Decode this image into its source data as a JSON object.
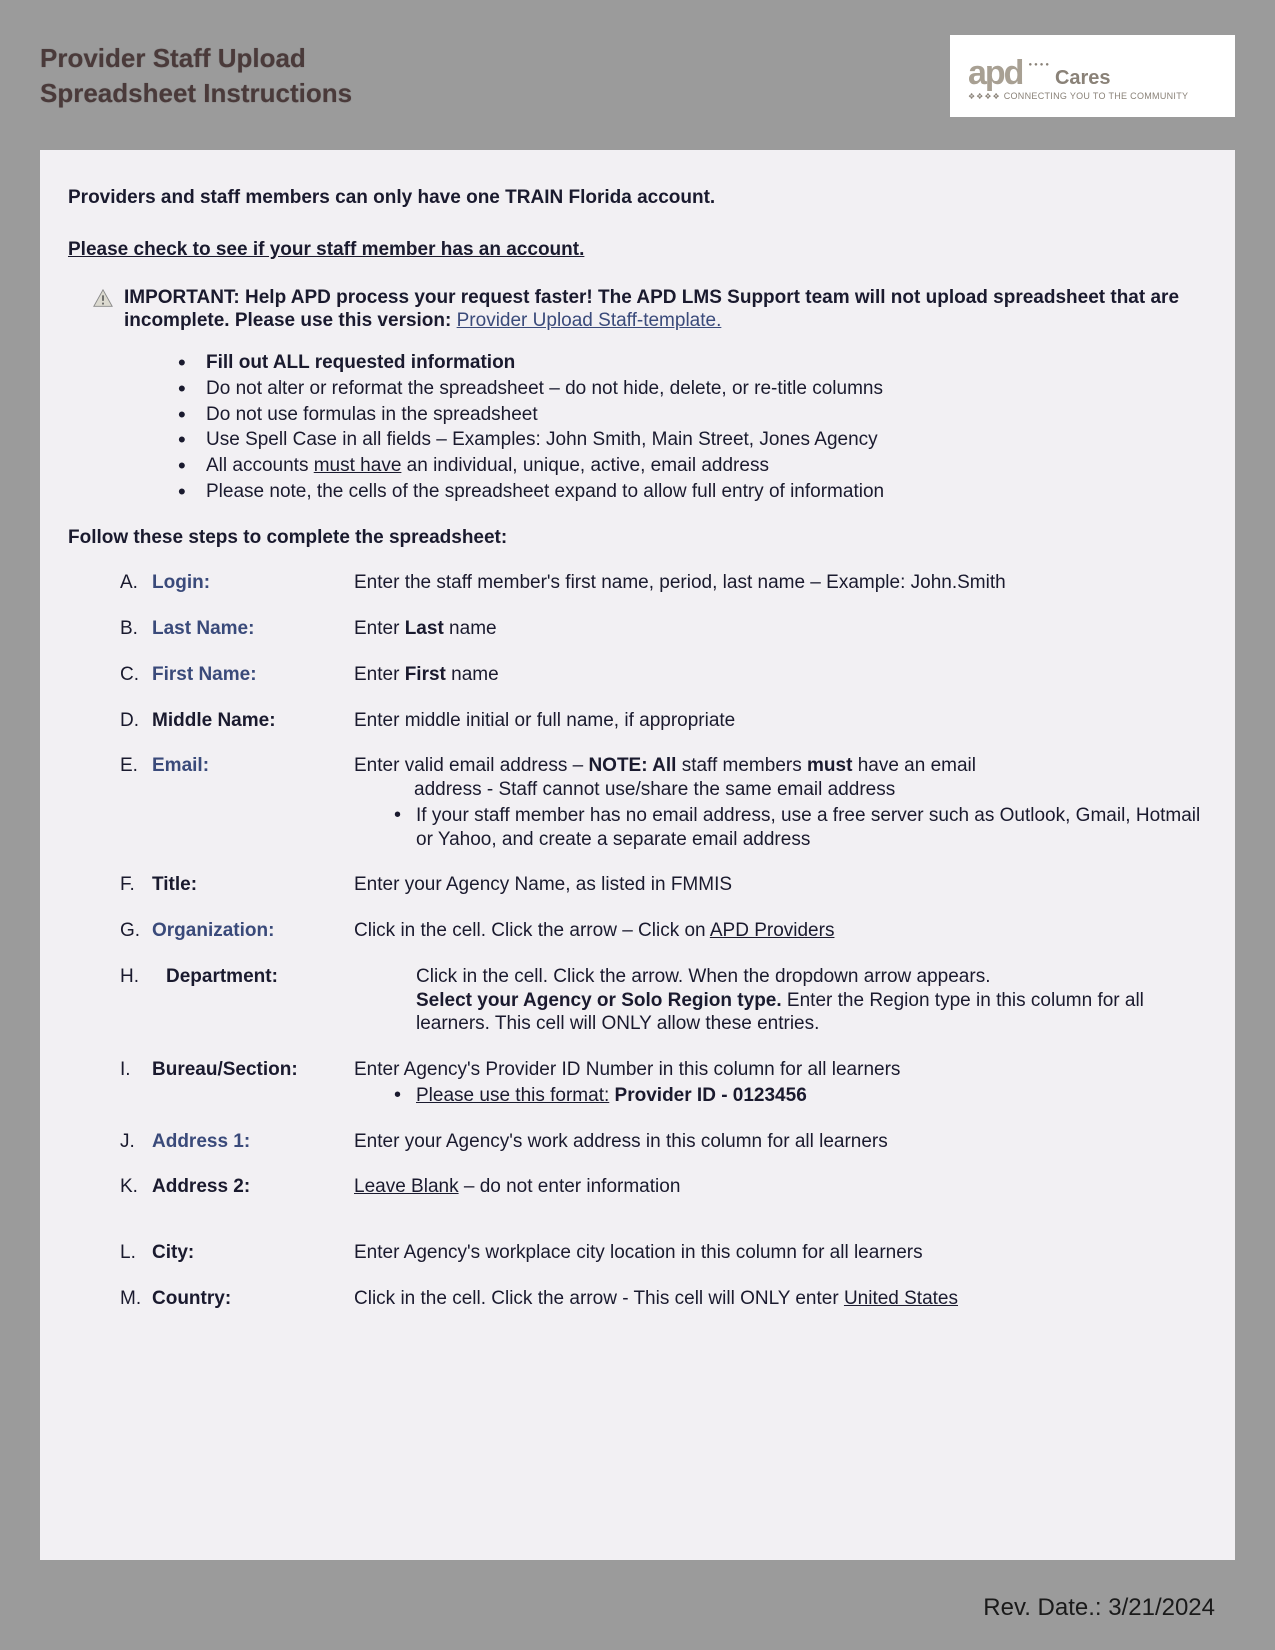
{
  "header": {
    "title_line1": "Provider Staff Upload",
    "title_line2": "Spreadsheet Instructions",
    "logo_brand": "apd",
    "logo_sub": "Cares",
    "logo_tagline": "CONNECTING YOU TO THE COMMUNITY"
  },
  "intro": "Providers and staff members can only have one TRAIN Florida account.",
  "check_link": "Please check to see if your staff member has an account.",
  "important": {
    "lead": "IMPORTANT:  Help APD process your request faster! The APD LMS Support team will not upload spreadsheet that are incomplete.  Please use this version:",
    "link_text": "Provider Upload Staff-template."
  },
  "rules": [
    {
      "bold": true,
      "text": "Fill out ALL requested information"
    },
    {
      "bold": false,
      "text": "Do not alter or reformat the spreadsheet – do not hide, delete, or re-title columns"
    },
    {
      "bold": false,
      "text": "Do not use formulas in the spreadsheet"
    },
    {
      "bold": false,
      "text": "Use Spell Case in all fields – Examples: John Smith, Main Street, Jones Agency"
    },
    {
      "bold": false,
      "pre": "All accounts ",
      "u": "must have",
      "post": " an individual, unique, active, email address"
    },
    {
      "bold": false,
      "text": "Please note, the cells of the spreadsheet expand to allow full entry of information"
    }
  ],
  "follow": "Follow these steps to complete the spreadsheet:",
  "steps": {
    "A": {
      "label": "Login:",
      "linkish": true,
      "desc": "Enter the staff member's first name, period, last name – Example: John.Smith"
    },
    "B": {
      "label": "Last Name:",
      "linkish": true,
      "desc_pre": "Enter ",
      "desc_b": "Last",
      "desc_post": " name"
    },
    "C": {
      "label": "First Name:",
      "linkish": true,
      "desc_pre": "Enter ",
      "desc_b": "First",
      "desc_post": " name"
    },
    "D": {
      "label": "Middle Name:",
      "desc": "Enter middle initial or full name, if appropriate"
    },
    "E": {
      "label": "Email:",
      "linkish": true,
      "line1_pre": "Enter valid email address – ",
      "line1_b1": "NOTE:  All",
      "line1_mid": " staff members ",
      "line1_b2": "must",
      "line1_post": " have an email",
      "line2": "address - Staff cannot use/share the same email address",
      "bullet": "If your staff member has no email address, use a free server such as Outlook, Gmail, Hotmail or Yahoo, and create a separate email address"
    },
    "F": {
      "label": "Title:",
      "desc": "Enter your Agency Name, as listed in FMMIS"
    },
    "G": {
      "label": "Organization:",
      "linkish": true,
      "desc_pre": "Click in the cell. Click the arrow – Click on ",
      "desc_u": "APD Providers"
    },
    "H": {
      "label": "Department:",
      "indent": true,
      "line1": "Click in the cell. Click the arrow. When the dropdown arrow appears.",
      "line2_b": "Select your Agency or Solo Region type.",
      "line2_post": " Enter the Region type in this column for all learners.  This cell will ONLY allow these entries."
    },
    "I": {
      "label": "Bureau/Section:",
      "line1": "Enter Agency's Provider ID Number in this column for all learners",
      "bullet_u": "Please use this format:",
      "bullet_b": " Provider ID - 0123456"
    },
    "J": {
      "label": "Address 1:",
      "linkish": true,
      "desc": "Enter your Agency's work address in this column for all learners"
    },
    "K": {
      "label": "Address 2:",
      "desc_u": "Leave Blank",
      "desc_post": " – do not enter information"
    },
    "L": {
      "label": "City:",
      "desc": "Enter Agency's workplace city location in this column for all learners"
    },
    "M": {
      "label": "Country:",
      "desc_pre": "Click in the cell. Click the arrow - This cell will ONLY enter ",
      "desc_u": "United States"
    }
  },
  "footer": "Rev. Date.: 3/21/2024"
}
